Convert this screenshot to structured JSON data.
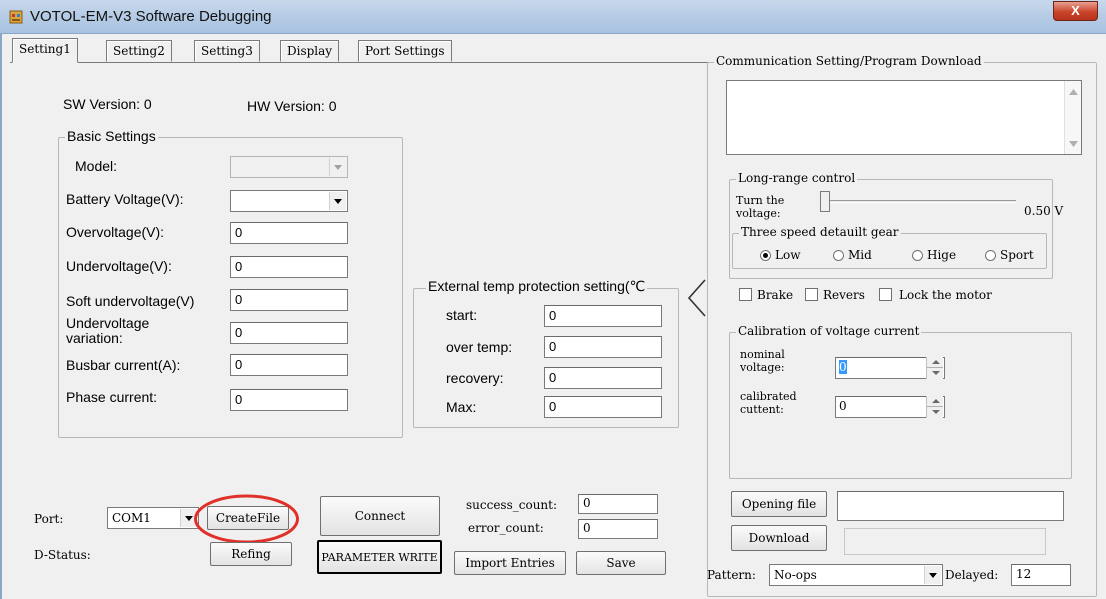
{
  "window": {
    "title": "VOTOL-EM-V3 Software Debugging",
    "close_glyph": "X"
  },
  "tabs": [
    "Setting1",
    "Setting2",
    "Setting3",
    "Display",
    "Port Settings"
  ],
  "versions": {
    "sw": "SW Version: 0",
    "hw": "HW Version: 0"
  },
  "basic_settings": {
    "title": "Basic Settings",
    "model_label": "Model:",
    "battery_label": "Battery Voltage(V):",
    "overvoltage_label": "Overvoltage(V):",
    "overvoltage_value": "0",
    "undervoltage_label": "Undervoltage(V):",
    "undervoltage_value": "0",
    "soft_undervoltage_label": "Soft undervoltage(V)",
    "soft_undervoltage_value": "0",
    "undervoltage_variation_label_1": "Undervoltage",
    "undervoltage_variation_label_2": "variation:",
    "undervoltage_variation_value": "0",
    "busbar_label": "Busbar current(A):",
    "busbar_value": "0",
    "phase_label": "Phase current:",
    "phase_value": "0"
  },
  "temp_protection": {
    "title": "External temp protection setting(℃",
    "start_label": "start:",
    "start_value": "0",
    "over_label": "over temp:",
    "over_value": "0",
    "recovery_label": "recovery:",
    "recovery_value": "0",
    "max_label": "Max:",
    "max_value": "0"
  },
  "port": {
    "port_label": "Port:",
    "port_value": "COM1",
    "create_file": "CreateFile",
    "connect": "Connect",
    "dstatus_label": "D-Status:",
    "refing": "Refing",
    "parameter_write": "PARAMETER WRITE",
    "success_label": "success_count:",
    "success_value": "0",
    "error_label": "error_count:",
    "error_value": "0",
    "import_entries": "Import Entries",
    "save": "Save"
  },
  "comm": {
    "title": "Communication Setting/Program Download",
    "long_range": {
      "title": "Long-range control",
      "turn_label_1": "Turn the",
      "turn_label_2": "voltage:",
      "voltage_value": "0.50 V",
      "slider_fraction": 0
    },
    "speed_gear": {
      "title": "Three speed detauilt gear",
      "options": [
        "Low",
        "Mid",
        "Hige",
        "Sport"
      ],
      "selected": "Low"
    },
    "checks": {
      "brake": "Brake",
      "reverse": "Revers",
      "lock": "Lock the motor"
    },
    "calibration": {
      "title": "Calibration of voltage current",
      "nominal_1": "nominal",
      "nominal_2": "voltage:",
      "nominal_value": "0",
      "calibrated_1": "calibrated",
      "calibrated_2": "cuttent:",
      "calibrated_value": "0"
    },
    "opening_file": "Opening file",
    "download": "Download",
    "pattern_label": "Pattern:",
    "pattern_value": "No-ops",
    "delayed_label": "Delayed:",
    "delayed_value": "12"
  },
  "colors": {
    "titlebar": "#b7cde6",
    "highlight_circle": "#e0302a",
    "selection": "#3399ff"
  }
}
